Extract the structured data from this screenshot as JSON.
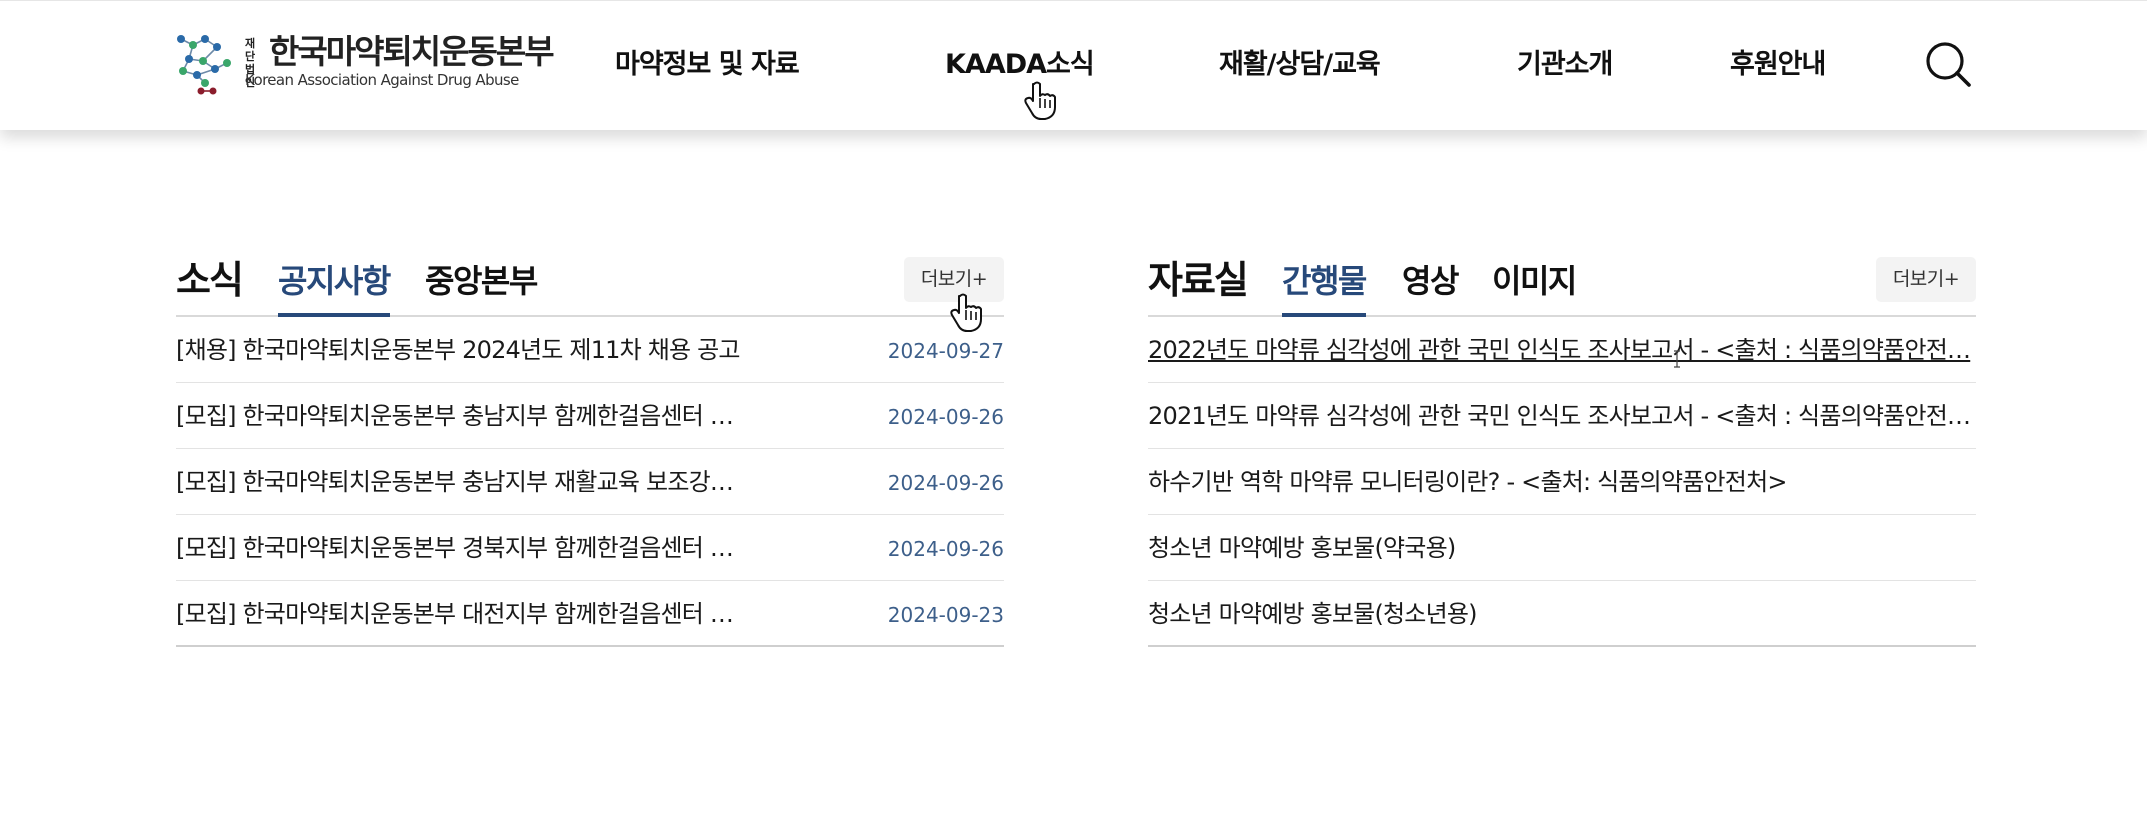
{
  "logo": {
    "small_text": "재단법인",
    "name_ko": "한국마약퇴치운동본부",
    "name_en": "Korean Association Against Drug Abuse"
  },
  "nav": {
    "items": [
      "마약정보 및 자료",
      "KAADA소식",
      "재활/상담/교육",
      "기관소개",
      "후원안내"
    ],
    "search_icon": "search-icon"
  },
  "news": {
    "title": "소식",
    "tabs": [
      "공지사항",
      "중앙본부"
    ],
    "active_tab": "공지사항",
    "more_label": "더보기+",
    "items": [
      {
        "title": "[채용] 한국마약퇴치운동본부 2024년도 제11차 채용 공고",
        "date": "2024-09-27"
      },
      {
        "title": "[모집] 한국마약퇴치운동본부 충남지부 함께한걸음센터 …",
        "date": "2024-09-26"
      },
      {
        "title": "[모집] 한국마약퇴치운동본부 충남지부 재활교육 보조강…",
        "date": "2024-09-26"
      },
      {
        "title": "[모집] 한국마약퇴치운동본부 경북지부 함께한걸음센터 …",
        "date": "2024-09-26"
      },
      {
        "title": "[모집] 한국마약퇴치운동본부 대전지부 함께한걸음센터 …",
        "date": "2024-09-23"
      }
    ]
  },
  "archive": {
    "title": "자료실",
    "tabs": [
      "간행물",
      "영상",
      "이미지"
    ],
    "active_tab": "간행물",
    "more_label": "더보기+",
    "items": [
      {
        "title": "2022년도 마약류 심각성에 관한 국민 인식도 조사보고서 - <출처 : 식품의약품안전…"
      },
      {
        "title": "2021년도 마약류 심각성에 관한 국민 인식도 조사보고서 - <출처 : 식품의약품안전…"
      },
      {
        "title": "하수기반 역학 마약류 모니터링이란? - <출처: 식품의약품안전처>"
      },
      {
        "title": "청소년 마약예방 홍보물(약국용)"
      },
      {
        "title": "청소년 마약예방 홍보물(청소년용)"
      }
    ]
  },
  "colors": {
    "accent": "#27497a",
    "date": "#3d5f8a",
    "logo_blue": "#2a6aa8",
    "logo_green": "#3aa66a",
    "logo_red": "#8b1d2c"
  }
}
